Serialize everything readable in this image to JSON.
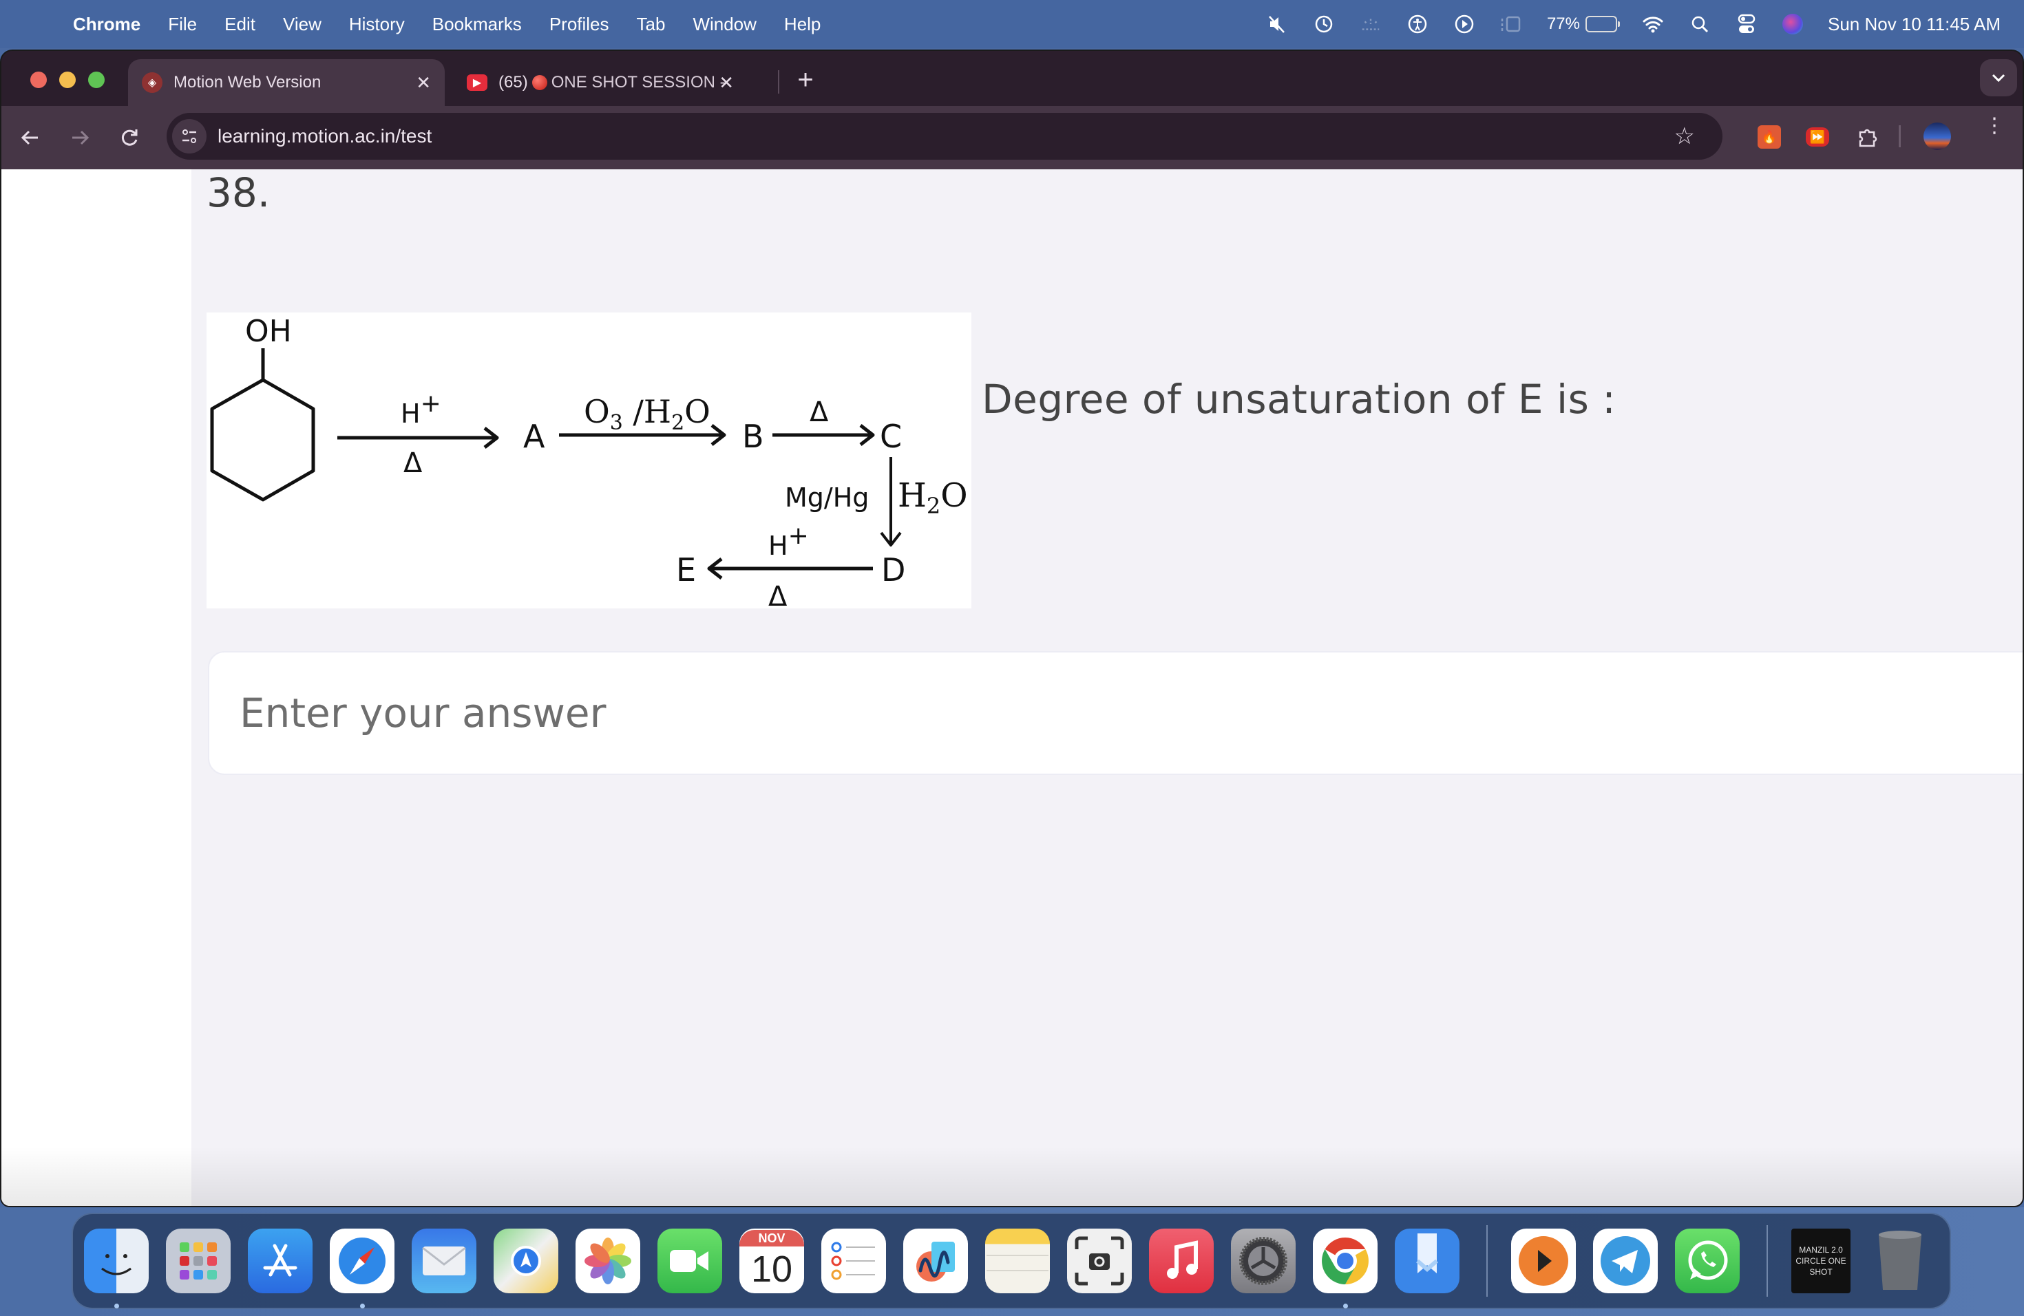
{
  "menubar": {
    "app_name": "Chrome",
    "items": [
      "File",
      "Edit",
      "View",
      "History",
      "Bookmarks",
      "Profiles",
      "Tab",
      "Window",
      "Help"
    ],
    "status_icons": [
      "muted-speaker-icon",
      "time-machine-icon",
      "brightness-icon",
      "accessibility-icon",
      "play-icon",
      "stage-manager-icon"
    ],
    "battery_percent": "77%",
    "battery_level": 0.77,
    "datetime": "Sun Nov 10  11:45 AM"
  },
  "browser": {
    "tabs": [
      {
        "title": "Motion Web Version",
        "active": true,
        "favicon": "motion-logo-icon"
      },
      {
        "title_prefix": "(65)",
        "title": "ONE SHOT SESSION -",
        "active": false,
        "favicon": "youtube-icon"
      }
    ],
    "new_tab_label": "+",
    "url": "learning.motion.ac.in/test"
  },
  "page": {
    "question_number": "38.",
    "question_text": "Degree of unsaturation of E is :",
    "answer_placeholder": "Enter your answer",
    "reaction": {
      "start_substituent": "OH",
      "step1_above": "H+",
      "step1_below": "Δ",
      "A": "A",
      "step2_reagent": "O3/H2O",
      "B": "B",
      "step3_above": "Δ",
      "C": "C",
      "step4_left": "Mg/Hg",
      "step4_right": "H2O",
      "D": "D",
      "step5_above": "H+",
      "step5_below": "Δ",
      "E": "E"
    }
  },
  "dock": {
    "apps": [
      {
        "name": "Finder",
        "running": true
      },
      {
        "name": "Launchpad",
        "running": false
      },
      {
        "name": "App Store",
        "running": false
      },
      {
        "name": "Safari",
        "running": true
      },
      {
        "name": "Mail",
        "running": false
      },
      {
        "name": "Maps",
        "running": false
      },
      {
        "name": "Photos",
        "running": false
      },
      {
        "name": "FaceTime",
        "running": false
      },
      {
        "name": "Calendar",
        "running": false,
        "month": "NOV",
        "day": "10"
      },
      {
        "name": "Reminders",
        "running": false
      },
      {
        "name": "Freeform",
        "running": false
      },
      {
        "name": "Notes",
        "running": false
      },
      {
        "name": "Screenshot",
        "running": false
      },
      {
        "name": "Music",
        "running": false
      },
      {
        "name": "System Settings",
        "running": false
      },
      {
        "name": "Google Chrome",
        "running": true
      },
      {
        "name": "Readwise",
        "running": false
      },
      {
        "name": "Infuse",
        "running": false
      },
      {
        "name": "Telegram",
        "running": false
      },
      {
        "name": "WhatsApp",
        "running": false
      },
      {
        "name": "Downloads Stack",
        "running": false,
        "label": "MANZIL 2.0 CIRCLE ONE SHOT"
      },
      {
        "name": "Trash",
        "running": false
      }
    ]
  }
}
